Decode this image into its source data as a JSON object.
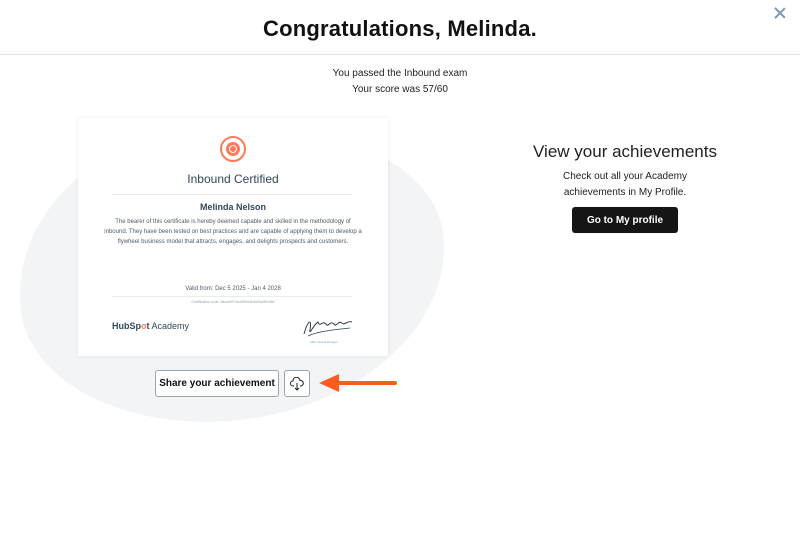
{
  "header": {
    "title": "Congratulations, Melinda."
  },
  "result": {
    "line1": "You passed the Inbound exam",
    "line2": "Your score was 57/60"
  },
  "certificate": {
    "title": "Inbound Certified",
    "name": "Melinda Nelson",
    "body": "The bearer of this certificate is hereby deemed capable and skilled in the methodology of inbound. They have been tested on best practices and are capable of applying them to develop a flywheel business model that attracts, engages, and delights prospects and customers.",
    "valid": "Valid from: Dec 5 2025 - Jan 4 2028",
    "code": "Certification code: a8cab9f724d4f53d2b36f9a0f53d84",
    "logo_brand_a": "HubSp",
    "logo_brand_dot": "o",
    "logo_brand_b": "t",
    "logo_sub": " Academy",
    "signature_caption": "CEO Yamini Rangan",
    "accent_color": "#ff7a59"
  },
  "actions": {
    "share_label": "Share your achievement",
    "download_icon": "cloud-download-icon",
    "arrow_color": "#ff5a1f"
  },
  "achievements": {
    "title": "View your achievements",
    "desc_line1": "Check out all your Academy",
    "desc_line2": "achievements in My Profile.",
    "button_label": "Go to My profile"
  }
}
